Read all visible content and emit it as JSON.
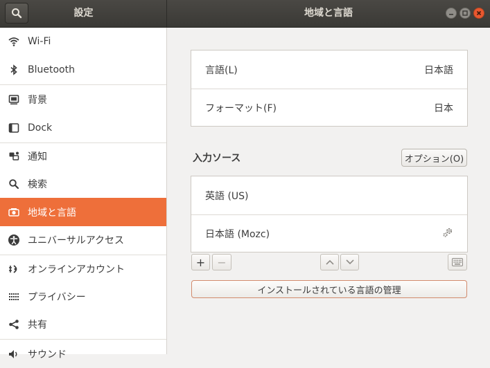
{
  "window": {
    "left_title": "設定",
    "right_title": "地域と言語"
  },
  "sidebar": {
    "items": [
      {
        "label": "Wi-Fi",
        "icon": "wifi-icon"
      },
      {
        "label": "Bluetooth",
        "icon": "bluetooth-icon"
      },
      {
        "label": "背景",
        "icon": "background-icon"
      },
      {
        "label": "Dock",
        "icon": "dock-icon"
      },
      {
        "label": "通知",
        "icon": "notifications-icon"
      },
      {
        "label": "検索",
        "icon": "search-icon"
      },
      {
        "label": "地域と言語",
        "icon": "region-icon",
        "active": true
      },
      {
        "label": "ユニバーサルアクセス",
        "icon": "accessibility-icon"
      },
      {
        "label": "オンラインアカウント",
        "icon": "online-accounts-icon"
      },
      {
        "label": "プライバシー",
        "icon": "privacy-icon"
      },
      {
        "label": "共有",
        "icon": "share-icon"
      },
      {
        "label": "サウンド",
        "icon": "sound-icon"
      }
    ]
  },
  "main": {
    "language": {
      "label": "言語(L)",
      "value": "日本語"
    },
    "format": {
      "label": "フォーマット(F)",
      "value": "日本"
    },
    "input_sources": {
      "title": "入力ソース",
      "options_label": "オプション(O)",
      "items": [
        {
          "label": "英語 (US)"
        },
        {
          "label": "日本語 (Mozc)"
        }
      ],
      "add_label": "+",
      "remove_label": "−"
    },
    "manage_label": "インストールされている言語の管理"
  },
  "colors": {
    "accent": "#ee6f3a",
    "titlebar": "#3f3e3a",
    "close": "#e9572f"
  }
}
